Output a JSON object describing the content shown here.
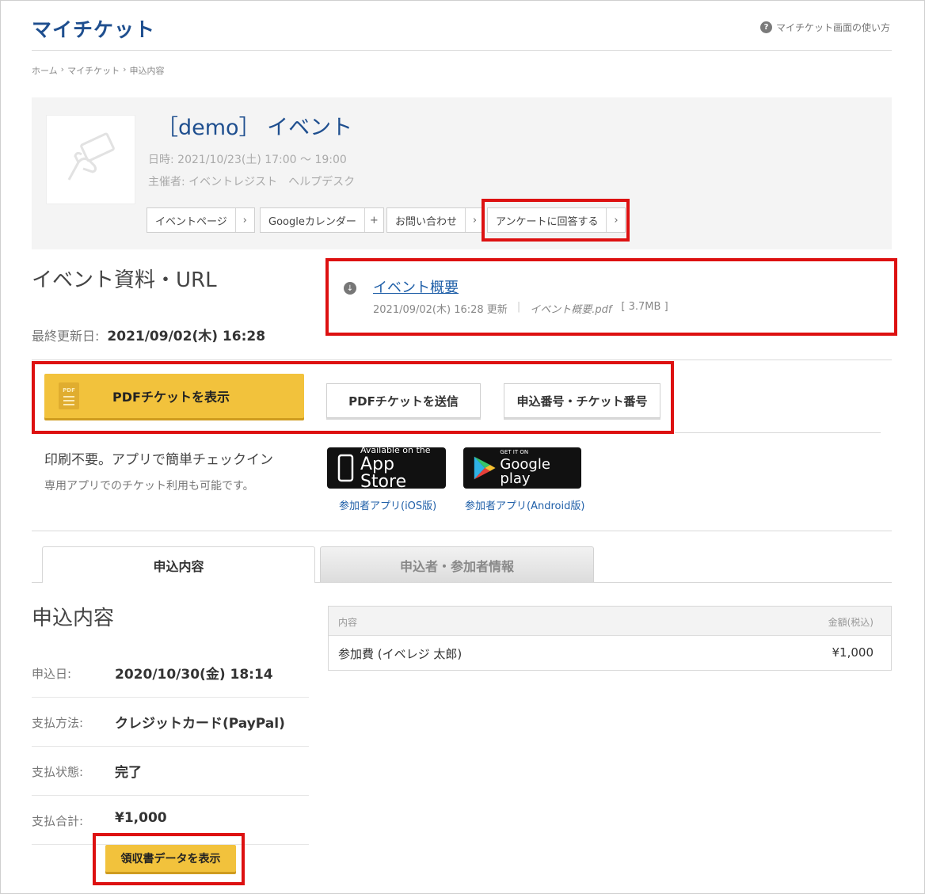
{
  "header": {
    "logo": "マイチケット",
    "help_link": "マイチケット画面の使い方"
  },
  "breadcrumb": [
    "ホーム",
    "マイチケット",
    "申込内容"
  ],
  "event": {
    "title": "［demo］ イベント",
    "datetime": "日時: 2021/10/23(土) 17:00 ～ 19:00",
    "organizer": "主催者: イベントレジスト　ヘルプデスク",
    "actions": [
      {
        "label": "イベントページ",
        "arrow": "›"
      },
      {
        "label": "Googleカレンダー",
        "arrow": "+"
      },
      {
        "label": "お問い合わせ",
        "arrow": "›"
      },
      {
        "label": "アンケートに回答する",
        "arrow": "›"
      }
    ]
  },
  "materials": {
    "title": "イベント資料・URL",
    "updated_label": "最終更新日:",
    "updated_value": "2021/09/02(木) 16:28",
    "document": {
      "name": "イベント概要",
      "updated": "2021/09/02(木) 16:28 更新",
      "file": "イベント概要.pdf",
      "size": "[ 3.7MB ]"
    }
  },
  "ticket_buttons": {
    "show_pdf": "PDFチケットを表示",
    "pdf_icon_text": "PDF",
    "send_pdf": "PDFチケットを送信",
    "numbers": "申込番号・チケット番号"
  },
  "app": {
    "headline": "印刷不要。アプリで簡単チェックイン",
    "sub": "専用アプリでのチケット利用も可能です。",
    "ios": {
      "small": "Available on the",
      "big": "App Store",
      "link": "参加者アプリ(iOS版)"
    },
    "android": {
      "small": "GET IT ON",
      "big": "Google play",
      "link": "参加者アプリ(Android版)"
    }
  },
  "tabs": [
    {
      "label": "申込内容",
      "active": true
    },
    {
      "label": "申込者・参加者情報",
      "active": false
    }
  ],
  "application": {
    "title": "申込内容",
    "rows": [
      {
        "label": "申込日:",
        "value": "2020/10/30(金) 18:14"
      },
      {
        "label": "支払方法:",
        "value": "クレジットカード(PayPal)"
      },
      {
        "label": "支払状態:",
        "value": "完了"
      },
      {
        "label": "支払合計:",
        "value": "¥1,000"
      }
    ],
    "receipt_button": "領収書データを表示",
    "table": {
      "headers": [
        "内容",
        "金額(税込)"
      ],
      "rows": [
        [
          "参加費 (イベレジ 太郎)",
          "¥1,000"
        ]
      ]
    }
  },
  "colors": {
    "brand": "#1f4f8f",
    "accent_yellow": "#f2c23c",
    "highlight_red": "#dd1111",
    "link": "#1f5fa8"
  }
}
